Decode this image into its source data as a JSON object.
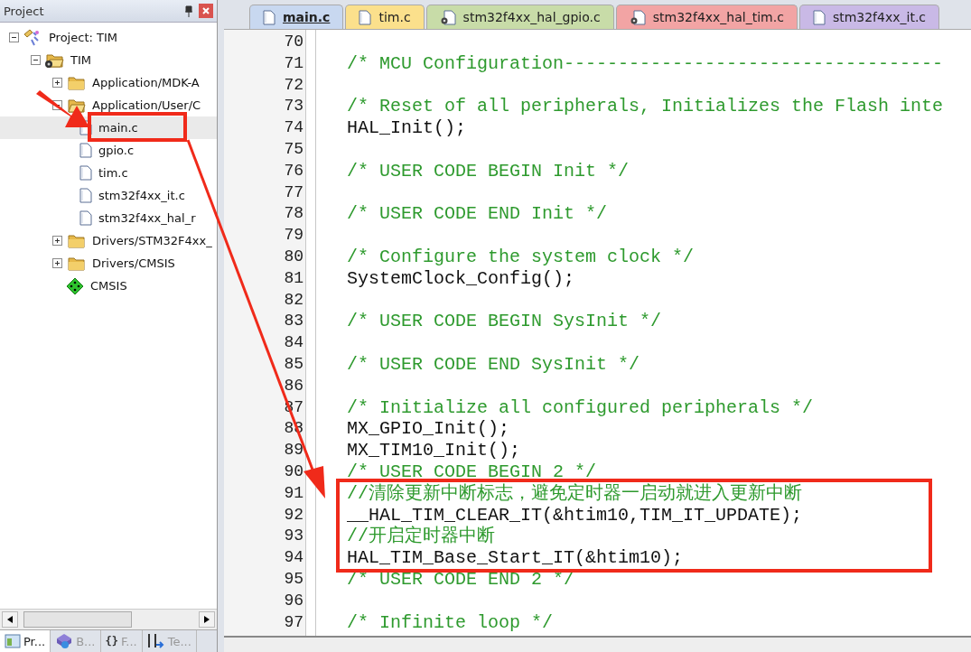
{
  "project_panel": {
    "title": "Project",
    "tree": [
      {
        "kind": "project",
        "label": "Project: TIM",
        "expanded": true,
        "children": [
          {
            "kind": "target",
            "label": "TIM",
            "expanded": true,
            "children": [
              {
                "kind": "group",
                "label": "Application/MDK-A",
                "expanded": false
              },
              {
                "kind": "group",
                "label": "Application/User/C",
                "expanded": true,
                "children": [
                  {
                    "kind": "file",
                    "label": "main.c",
                    "selected": true
                  },
                  {
                    "kind": "file",
                    "label": "gpio.c",
                    "selected": false
                  },
                  {
                    "kind": "file",
                    "label": "tim.c",
                    "selected": false
                  },
                  {
                    "kind": "file",
                    "label": "stm32f4xx_it.c",
                    "selected": false
                  },
                  {
                    "kind": "file",
                    "label": "stm32f4xx_hal_r",
                    "selected": false
                  }
                ]
              },
              {
                "kind": "group",
                "label": "Drivers/STM32F4xx_",
                "expanded": false
              },
              {
                "kind": "group",
                "label": "Drivers/CMSIS",
                "expanded": false
              },
              {
                "kind": "component",
                "label": "CMSIS"
              }
            ]
          }
        ]
      }
    ],
    "bottom_tabs": [
      {
        "kind": "project",
        "label": "Pr...",
        "selected": true
      },
      {
        "kind": "books",
        "label": "B...",
        "selected": false
      },
      {
        "kind": "functions",
        "glyph": "{}",
        "label": "F...",
        "selected": false
      },
      {
        "kind": "templates",
        "label": "Te...",
        "selected": false
      }
    ]
  },
  "editor": {
    "tabs": [
      {
        "label": "main.c",
        "color": "#c8d8f0",
        "kind": "file",
        "selected": true
      },
      {
        "label": "tim.c",
        "color": "#fbe08c",
        "kind": "file",
        "selected": false
      },
      {
        "label": "stm32f4xx_hal_gpio.c",
        "color": "#c8dca8",
        "kind": "gear-file",
        "selected": false
      },
      {
        "label": "stm32f4xx_hal_tim.c",
        "color": "#f2a4a4",
        "kind": "gear-file",
        "selected": false
      },
      {
        "label": "stm32f4xx_it.c",
        "color": "#c9b9e6",
        "kind": "file",
        "selected": false
      }
    ],
    "lines": [
      {
        "number": "70",
        "kind": "blank"
      },
      {
        "number": "71",
        "kind": "comment",
        "text": "/* MCU Configuration-----------------------------------"
      },
      {
        "number": "72",
        "kind": "blank"
      },
      {
        "number": "73",
        "kind": "comment",
        "text": "/* Reset of all peripherals, Initializes the Flash inte"
      },
      {
        "number": "74",
        "kind": "code",
        "text": "HAL_Init();"
      },
      {
        "number": "75",
        "kind": "blank"
      },
      {
        "number": "76",
        "kind": "comment",
        "text": "/* USER CODE BEGIN Init */"
      },
      {
        "number": "77",
        "kind": "blank"
      },
      {
        "number": "78",
        "kind": "comment",
        "text": "/* USER CODE END Init */"
      },
      {
        "number": "79",
        "kind": "blank"
      },
      {
        "number": "80",
        "kind": "comment",
        "text": "/* Configure the system clock */"
      },
      {
        "number": "81",
        "kind": "code",
        "text": "SystemClock_Config();"
      },
      {
        "number": "82",
        "kind": "blank"
      },
      {
        "number": "83",
        "kind": "comment",
        "text": "/* USER CODE BEGIN SysInit */"
      },
      {
        "number": "84",
        "kind": "blank"
      },
      {
        "number": "85",
        "kind": "comment",
        "text": "/* USER CODE END SysInit */"
      },
      {
        "number": "86",
        "kind": "blank"
      },
      {
        "number": "87",
        "kind": "comment",
        "text": "/* Initialize all configured peripherals */"
      },
      {
        "number": "88",
        "kind": "code",
        "text": "MX_GPIO_Init();"
      },
      {
        "number": "89",
        "kind": "code",
        "text": "MX_TIM10_Init();"
      },
      {
        "number": "90",
        "kind": "comment",
        "text": "/* USER CODE BEGIN 2 */"
      },
      {
        "number": "91",
        "kind": "comment",
        "text": "//清除更新中断标志，避免定时器一启动就进入更新中断"
      },
      {
        "number": "92",
        "kind": "code",
        "text": "__HAL_TIM_CLEAR_IT(&htim10,TIM_IT_UPDATE);"
      },
      {
        "number": "93",
        "kind": "comment",
        "text": "//开启定时器中断"
      },
      {
        "number": "94",
        "kind": "code",
        "text": "HAL_TIM_Base_Start_IT(&htim10);"
      },
      {
        "number": "95",
        "kind": "comment",
        "text": "/* USER CODE END 2 */"
      },
      {
        "number": "96",
        "kind": "blank"
      },
      {
        "number": "97",
        "kind": "comment",
        "text": "/* Infinite loop */"
      }
    ]
  }
}
